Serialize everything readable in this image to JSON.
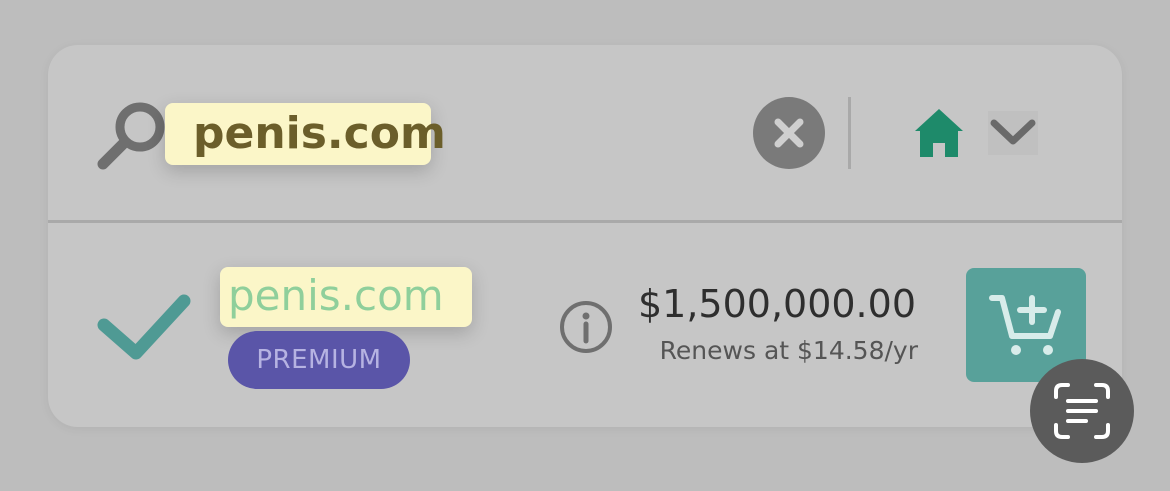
{
  "search": {
    "query": "penis.com",
    "icon": "search-icon",
    "clear_icon": "close-icon",
    "home_icon": "home-icon",
    "dropdown_icon": "chevron-down-icon"
  },
  "result": {
    "domain": "penis.com",
    "badge": "PREMIUM",
    "price": "$1,500,000.00",
    "renewal": "Renews at $14.58/yr",
    "status_icon": "check-icon",
    "info_icon": "info-icon",
    "cart_icon": "add-to-cart-icon"
  },
  "overlay": {
    "scan_icon": "scan-text-icon"
  },
  "colors": {
    "background": "#bdbdbd",
    "card": "#c6c6c6",
    "highlight": "#fbf6c8",
    "home_green": "#1e8a6a",
    "check_teal": "#4f9a94",
    "domain_green": "#8fcf9b",
    "premium_purple": "#5a55a8",
    "cart_teal": "#58a19a",
    "scan_button": "#5b5b5b"
  }
}
